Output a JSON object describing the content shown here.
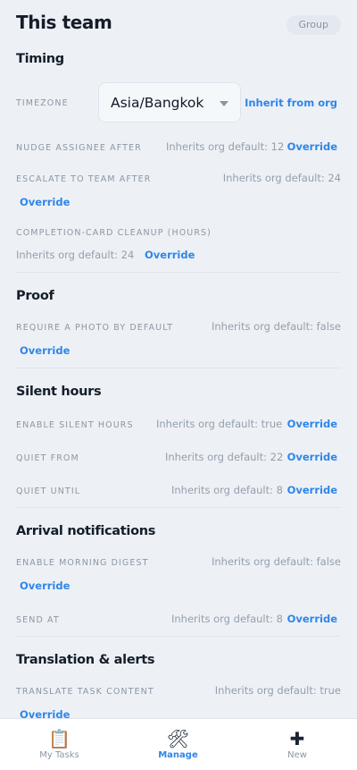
{
  "header": {
    "title": "This team",
    "badge": "Group"
  },
  "timing": {
    "title": "Timing",
    "timezone": {
      "label": "TIMEZONE",
      "value": "Asia/Bangkok",
      "action": "Inherit from org"
    },
    "nudge": {
      "label": "NUDGE ASSIGNEE AFTER",
      "inherit": "Inherits org default: 12",
      "action": "Override"
    },
    "escalate": {
      "label": "ESCALATE TO TEAM AFTER",
      "inherit": "Inherits org default: 24",
      "action": "Override"
    },
    "cleanup": {
      "label": "COMPLETION-CARD CLEANUP (HOURS)",
      "inherit": "Inherits org default: 24",
      "action": "Override"
    }
  },
  "proof": {
    "title": "Proof",
    "photo": {
      "label": "REQUIRE A PHOTO BY DEFAULT",
      "inherit": "Inherits org default: false",
      "action": "Override"
    }
  },
  "silent": {
    "title": "Silent hours",
    "enable": {
      "label": "ENABLE SILENT HOURS",
      "inherit": "Inherits org default: true",
      "action": "Override"
    },
    "from": {
      "label": "QUIET FROM",
      "inherit": "Inherits org default: 22",
      "action": "Override"
    },
    "until": {
      "label": "QUIET UNTIL",
      "inherit": "Inherits org default: 8",
      "action": "Override"
    }
  },
  "arrival": {
    "title": "Arrival notifications",
    "digest": {
      "label": "ENABLE MORNING DIGEST",
      "inherit": "Inherits org default: false",
      "action": "Override"
    },
    "send_at": {
      "label": "SEND AT",
      "inherit": "Inherits org default: 8",
      "action": "Override"
    }
  },
  "translation": {
    "title": "Translation & alerts",
    "translate": {
      "label": "TRANSLATE TASK CONTENT",
      "inherit": "Inherits org default: true",
      "action": "Override"
    }
  },
  "nav": {
    "my_tasks": {
      "label": "My Tasks",
      "icon": "📋"
    },
    "manage": {
      "label": "Manage",
      "icon": "🛠"
    },
    "new": {
      "label": "New",
      "icon": "✚"
    }
  },
  "colors": {
    "accent": "#2f86e8",
    "background": "#edf1f6",
    "muted": "#949eac"
  }
}
